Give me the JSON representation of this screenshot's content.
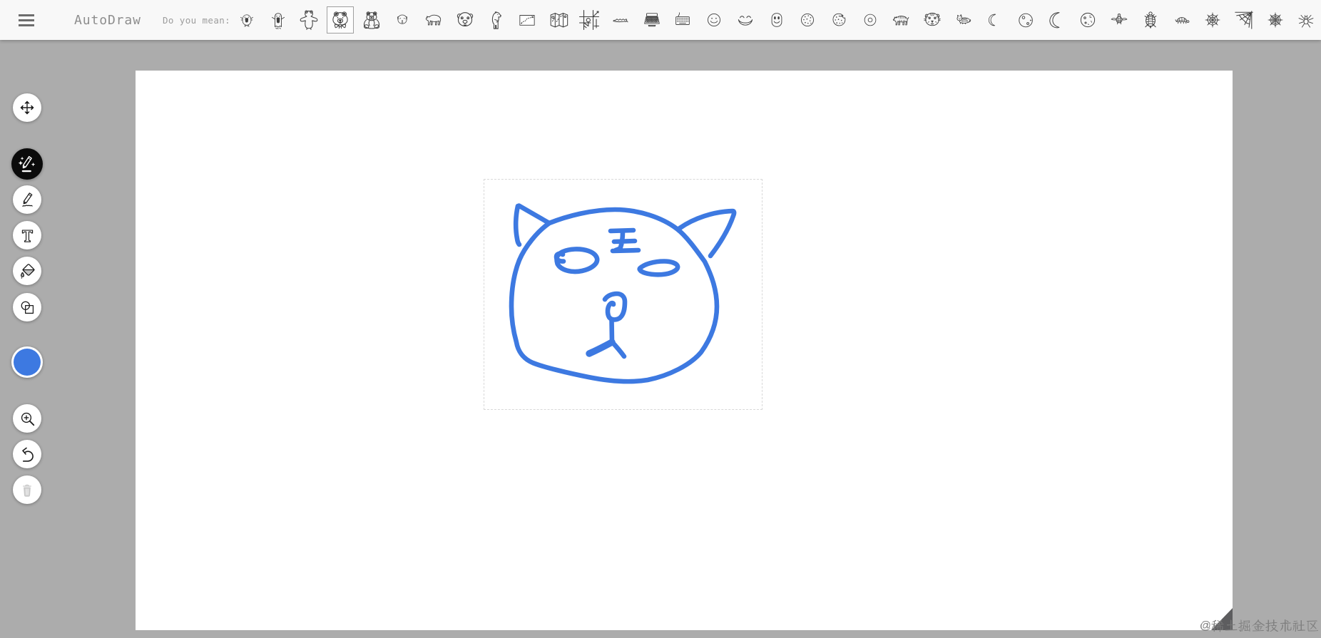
{
  "app": {
    "title": "AutoDraw"
  },
  "header": {
    "suggest_label": "Do you mean:",
    "selected_index": 3,
    "suggestions": [
      {
        "name": "monster-icon"
      },
      {
        "name": "ghost-icon"
      },
      {
        "name": "teddy-outline-icon"
      },
      {
        "name": "bear-bow-head-icon"
      },
      {
        "name": "teddy-bear-icon"
      },
      {
        "name": "bear-head-icon"
      },
      {
        "name": "bear-walking-icon"
      },
      {
        "name": "bear-face-icon"
      },
      {
        "name": "bear-standing-icon"
      },
      {
        "name": "treasure-map-icon"
      },
      {
        "name": "folded-map-icon"
      },
      {
        "name": "street-map-icon"
      },
      {
        "name": "scribble-icon"
      },
      {
        "name": "typewriter-icon"
      },
      {
        "name": "keyboard-icon"
      },
      {
        "name": "smiley-icon"
      },
      {
        "name": "grin-icon"
      },
      {
        "name": "smiley-oval-icon"
      },
      {
        "name": "cookie-icon"
      },
      {
        "name": "bitten-cookie-icon"
      },
      {
        "name": "donut-icon"
      },
      {
        "name": "tiger-icon"
      },
      {
        "name": "tiger-face-icon"
      },
      {
        "name": "lying-cat-icon"
      },
      {
        "name": "thin-crescent-icon"
      },
      {
        "name": "cratered-moon-icon"
      },
      {
        "name": "crescent-moon-icon"
      },
      {
        "name": "marked-moon-icon"
      },
      {
        "name": "sea-turtle-icon"
      },
      {
        "name": "turtle-top-icon"
      },
      {
        "name": "turtle-side-icon"
      },
      {
        "name": "spiderweb-icon"
      },
      {
        "name": "corner-spiderweb-icon"
      },
      {
        "name": "dense-spiderweb-icon"
      },
      {
        "name": "spider-icon"
      }
    ]
  },
  "toolbar": {
    "tools": [
      {
        "name": "select"
      },
      {
        "name": "autodraw"
      },
      {
        "name": "draw"
      },
      {
        "name": "type"
      },
      {
        "name": "fill"
      },
      {
        "name": "shape"
      },
      {
        "name": "color"
      },
      {
        "name": "zoom"
      },
      {
        "name": "undo"
      },
      {
        "name": "delete"
      }
    ],
    "current_color": "#3D79E1"
  },
  "canvas": {
    "watermark": "@稀土掘金技术社区",
    "stroke_color": "#3D79E1"
  },
  "colors": {
    "background": "#ACACAC",
    "topbar": "#F8F8F8",
    "accent": "#3D79E1"
  }
}
